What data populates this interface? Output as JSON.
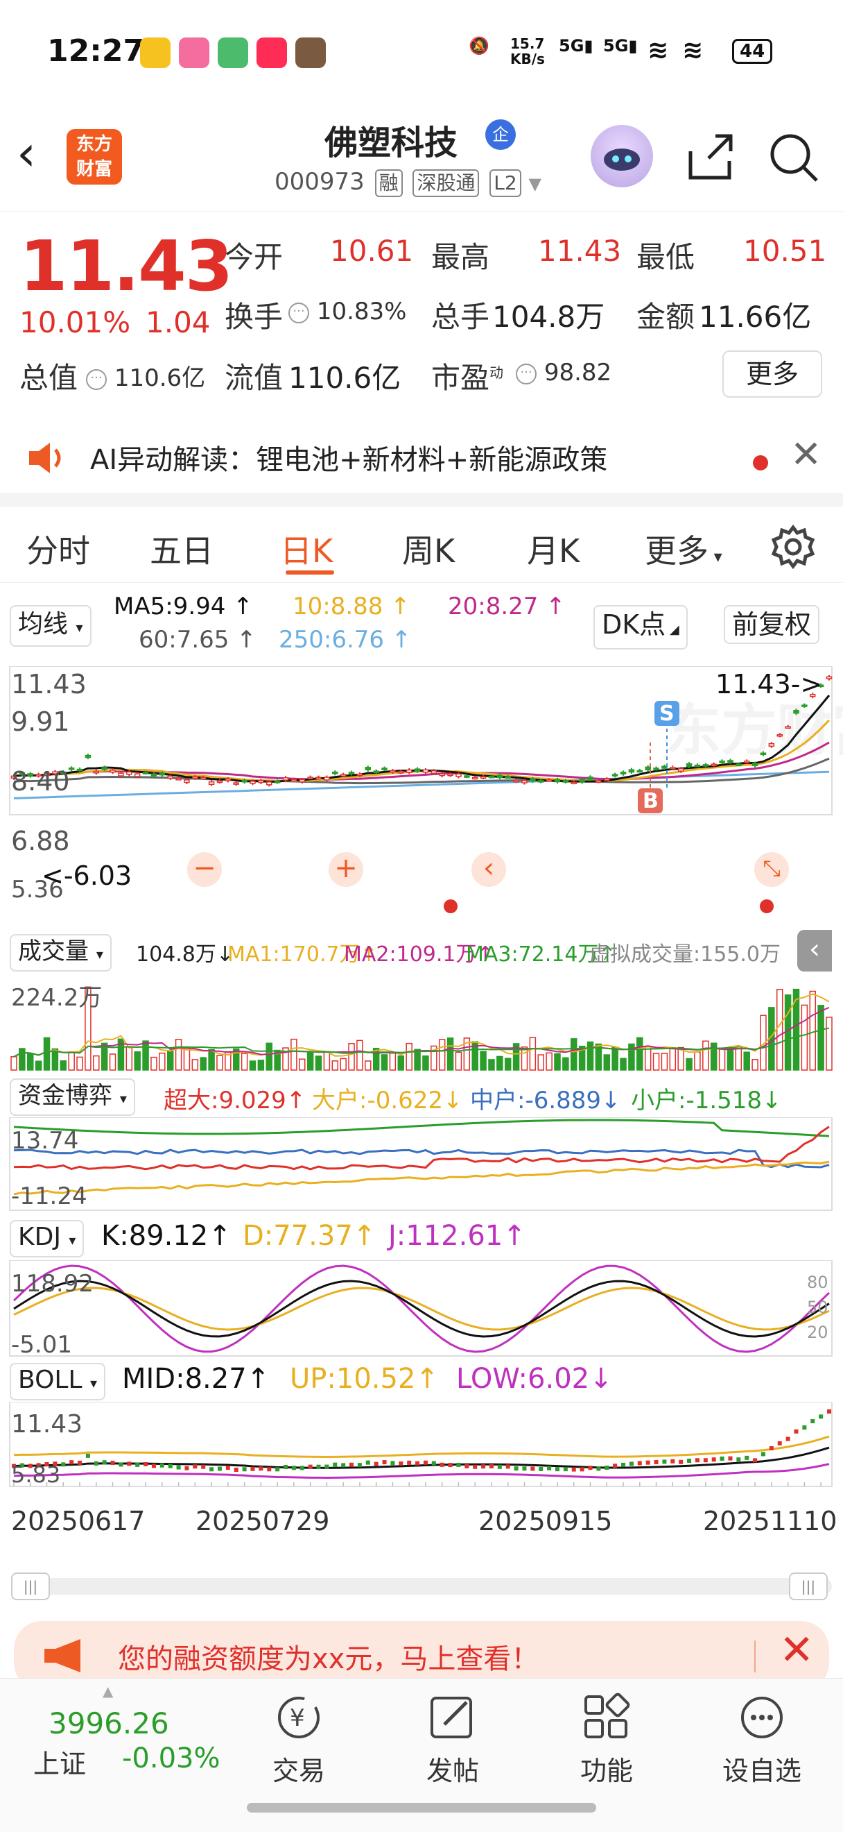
{
  "status": {
    "time": "12:27",
    "speed": "15.7\nKB/s",
    "net1": "5G",
    "net2": "5G",
    "battery": "44"
  },
  "header": {
    "logo_line1": "东方",
    "logo_line2": "财富",
    "name": "佛塑科技",
    "badge": "企",
    "code": "000973",
    "tags": [
      "融",
      "深股通",
      "L2"
    ]
  },
  "quote": {
    "price": "11.43",
    "pct": "10.01%",
    "change": "1.04",
    "open_label": "今开",
    "open": "10.61",
    "high_label": "最高",
    "high": "11.43",
    "low_label": "最低",
    "low": "10.51",
    "turnover_label": "换手",
    "turnover": "10.83%",
    "volume_label": "总手",
    "volume": "104.8万",
    "amount_label": "金额",
    "amount": "11.66亿",
    "mktcap_label": "总值",
    "mktcap": "110.6亿",
    "float_label": "流值",
    "float": "110.6亿",
    "pe_label": "市盈",
    "pe_sup": "动",
    "pe": "98.82",
    "more": "更多"
  },
  "ai": {
    "text": "AI异动解读：锂电池+新材料+新能源政策"
  },
  "tabs": [
    "分时",
    "五日",
    "日K",
    "周K",
    "月K",
    "更多"
  ],
  "active_tab": "日K",
  "chart": {
    "ma_select": "均线",
    "ma5": "MA5:9.94 ↑",
    "ma10": "10:8.88 ↑",
    "ma20": "20:8.27 ↑",
    "ma60": "60:7.65 ↑",
    "ma250": "250:6.76 ↑",
    "dk_btn": "DK点",
    "fq_btn": "前复权",
    "y_top": "11.43",
    "y2": "9.91",
    "y3": "8.40",
    "y4": "6.88",
    "y_bottom": "5.36",
    "last_label": "11.43->",
    "low_label": "<-6.03",
    "marker_s": "S",
    "marker_b": "B",
    "vol_select": "成交量",
    "vol_now": "104.8万↓",
    "vol_ma1": "MA1:170.7万↑",
    "vol_ma2": "MA2:109.1万↑",
    "vol_ma3": "MA3:72.14万↑",
    "vol_virtual": "虚拟成交量:155.0万",
    "vol_max": "224.2万",
    "flow_select": "资金博弈",
    "flow_super": "超大:9.029↑",
    "flow_big": "大户:-0.622↓",
    "flow_mid": "中户:-6.889↓",
    "flow_small": "小户:-1.518↓",
    "flow_top": "13.74",
    "flow_bottom": "-11.24",
    "kdj_select": "KDJ",
    "kdj_k": "K:89.12↑",
    "kdj_d": "D:77.37↑",
    "kdj_j": "J:112.61↑",
    "kdj_top": "118.92",
    "kdj_bottom": "-5.01",
    "kdj_80": "80",
    "kdj_50": "50",
    "kdj_20": "20",
    "boll_select": "BOLL",
    "boll_mid": "MID:8.27↑",
    "boll_up": "UP:10.52↑",
    "boll_low": "LOW:6.02↓",
    "boll_top": "11.43",
    "boll_bottom": "5.83",
    "dates": [
      "20250617",
      "20250729",
      "20250915",
      "20251110"
    ]
  },
  "promo": {
    "text": "您的融资额度为xx元，马上查看！"
  },
  "bottom": {
    "index_value": "3996.26",
    "index_name": "上证",
    "index_change": "-0.03%",
    "items": [
      "交易",
      "发帖",
      "功能",
      "设自选"
    ]
  },
  "colors": {
    "up": "#e0302a",
    "down": "#2a9d2a",
    "accent": "#ee5a24",
    "ma5": "#111111",
    "ma10": "#e8b020",
    "ma20": "#c0288a",
    "ma60": "#666666",
    "ma250": "#6aaee0"
  }
}
